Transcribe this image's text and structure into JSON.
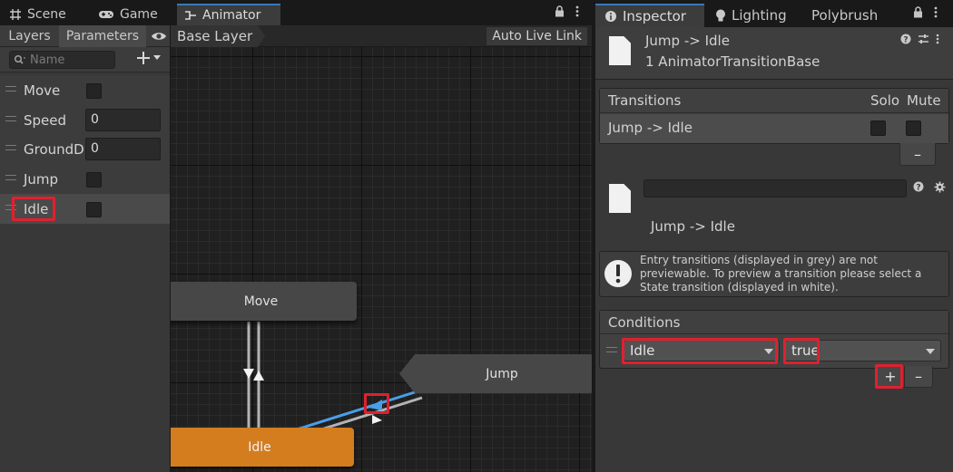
{
  "left_tabs": [
    {
      "label": "Scene",
      "icon": "grid-icon"
    },
    {
      "label": "Game",
      "icon": "gamepad-icon"
    },
    {
      "label": "Animator",
      "icon": "animator-icon"
    }
  ],
  "parameters_panel": {
    "tabs": [
      "Layers",
      "Parameters"
    ],
    "search_placeholder": "Name",
    "params": [
      {
        "name": "Move",
        "type": "bool"
      },
      {
        "name": "Speed",
        "type": "float",
        "value": "0"
      },
      {
        "name": "GroundDi",
        "type": "float",
        "value": "0"
      },
      {
        "name": "Jump",
        "type": "trigger"
      },
      {
        "name": "Idle",
        "type": "bool"
      }
    ]
  },
  "graph": {
    "breadcrumb": "Base Layer",
    "live_link_button": "Auto Live Link",
    "states": {
      "move": "Move",
      "jump": "Jump",
      "idle": "Idle"
    },
    "colors": {
      "default_state": "#474747",
      "default_state_entry": "#d47d1f",
      "selected_transition": "#4a9ee8"
    }
  },
  "inspector": {
    "tabs": [
      {
        "label": "Inspector",
        "icon": "info-icon"
      },
      {
        "label": "Lighting",
        "icon": "bulb-icon"
      },
      {
        "label": "Polybrush",
        "icon": ""
      }
    ],
    "header_title": "Jump -> Idle",
    "header_subtitle": "1 AnimatorTransitionBase",
    "transitions_table": {
      "headers": [
        "Transitions",
        "Solo",
        "Mute"
      ],
      "rows": [
        {
          "name": "Jump -> Idle"
        }
      ]
    },
    "transition_name_value": "",
    "transition_label": "Jump -> Idle",
    "info_message": "Entry transitions (displayed in grey) are not previewable. To preview a transition please select a State transition (displayed in white).",
    "conditions": {
      "title": "Conditions",
      "rows": [
        {
          "parameter": "Idle",
          "value": "true"
        }
      ]
    },
    "add_label": "+",
    "remove_label": "–"
  }
}
